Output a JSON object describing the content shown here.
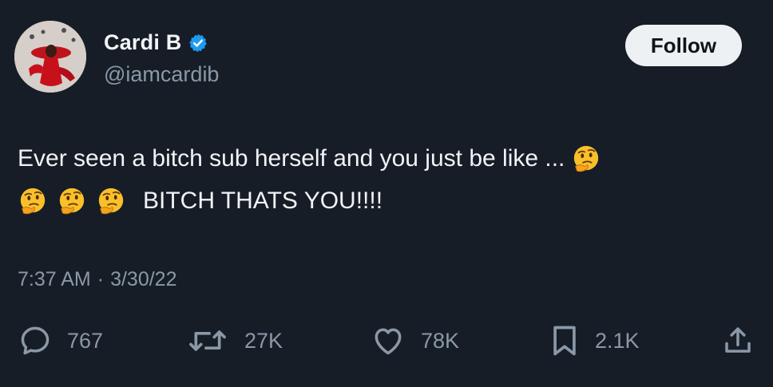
{
  "user": {
    "display_name": "Cardi B",
    "handle": "@iamcardib",
    "verified": true
  },
  "follow_button": {
    "label": "Follow"
  },
  "tweet": {
    "line1": "Ever seen a bitch sub herself and you just be like ...",
    "line2": "BITCH THATS YOU!!!!",
    "emoji": "thinking-face"
  },
  "timestamp": {
    "time": "7:37 AM",
    "separator": "·",
    "date": "3/30/22"
  },
  "actions": {
    "replies": "767",
    "retweets": "27K",
    "likes": "78K",
    "bookmarks": "2.1K"
  },
  "colors": {
    "background": "#161d27",
    "text": "#f1f3f5",
    "muted": "#8a98a7",
    "verified": "#1d9bf0",
    "follow_bg": "#eef1f3"
  }
}
